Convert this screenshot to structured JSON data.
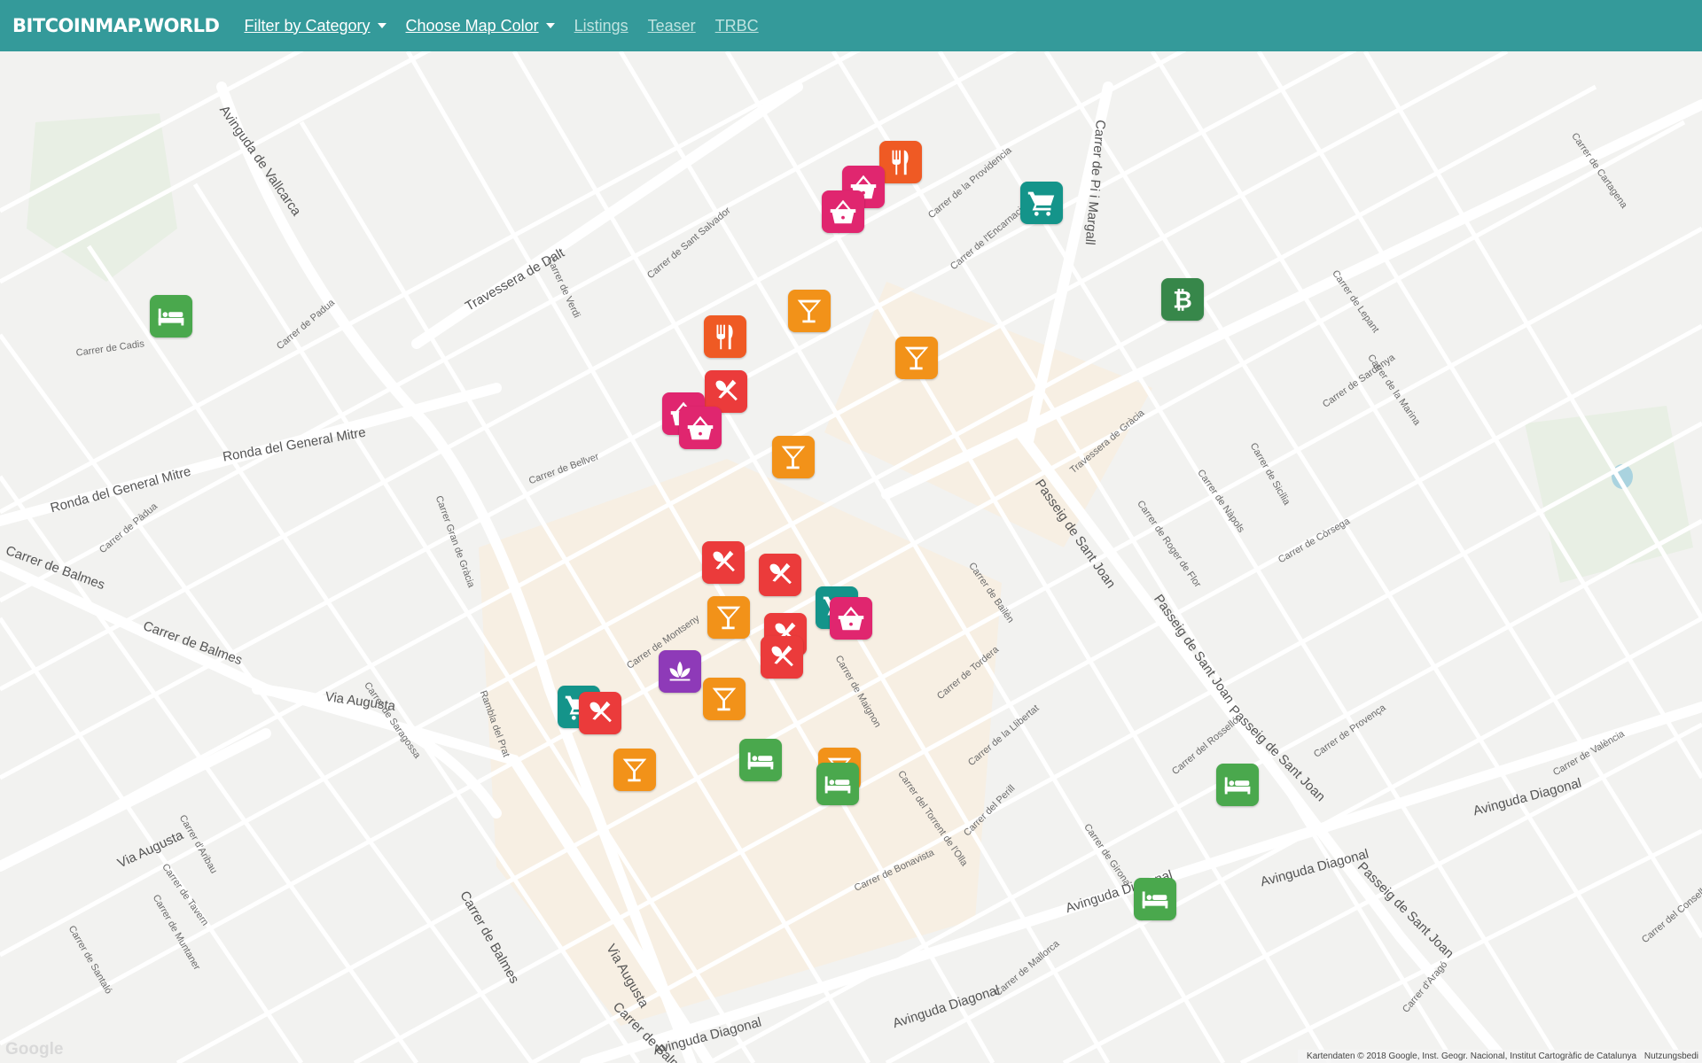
{
  "nav": {
    "brand": "BITCOINMAP.WORLD",
    "filter_label": "Filter by Category",
    "color_label": "Choose Map Color",
    "listings_label": "Listings",
    "teaser_label": "Teaser",
    "trbc_label": "TRBC"
  },
  "map": {
    "streets": [
      {
        "text": "Avinguda de Vallcarca",
        "big": true
      },
      {
        "text": "Travessera de Dalt",
        "big": true
      },
      {
        "text": "Ronda del General Mitre",
        "big": true
      },
      {
        "text": "Ronda del General Mitre",
        "big": true
      },
      {
        "text": "Carrer de Balmes",
        "big": true
      },
      {
        "text": "Carrer de Balmes",
        "big": true
      },
      {
        "text": "Via Augusta",
        "big": true
      },
      {
        "text": "Via Augusta",
        "big": true
      },
      {
        "text": "Via Augusta",
        "big": true
      },
      {
        "text": "Carrer de Balmes",
        "big": true
      },
      {
        "text": "Carrer de Balmes",
        "big": true
      },
      {
        "text": "Passeig de Sant Joan",
        "big": true
      },
      {
        "text": "Passeig de Sant Joan",
        "big": true
      },
      {
        "text": "Passeig de Sant Joan",
        "big": true
      },
      {
        "text": "Passeig de Sant Joan",
        "big": true
      },
      {
        "text": "Avinguda Diagonal",
        "big": true
      },
      {
        "text": "Avinguda Diagonal",
        "big": true
      },
      {
        "text": "Avinguda Diagonal",
        "big": true
      },
      {
        "text": "Avinguda Diagonal",
        "big": true
      },
      {
        "text": "Avinguda Diagonal",
        "big": true
      },
      {
        "text": "Carrer de Pi i Margall",
        "big": true
      },
      {
        "text": "Carrer de Cadis",
        "big": false
      },
      {
        "text": "Carrer de Padua",
        "big": false
      },
      {
        "text": "Carrer de Bellver",
        "big": false
      },
      {
        "text": "Carrer de Verdi",
        "big": false
      },
      {
        "text": "Carrer de Sant Salvador",
        "big": false
      },
      {
        "text": "Carrer de la Providencia",
        "big": false
      },
      {
        "text": "Carrer de l'Encarnació",
        "big": false
      },
      {
        "text": "Travessera de Gràcia",
        "big": false
      },
      {
        "text": "Carrer de Sardenya",
        "big": false
      },
      {
        "text": "Carrer de Sicília",
        "big": false
      },
      {
        "text": "Carrer de Nàpols",
        "big": false
      },
      {
        "text": "Carrer de Roger de Flor",
        "big": false
      },
      {
        "text": "Carrer de Còrsega",
        "big": false
      },
      {
        "text": "Carrer del Rosselló",
        "big": false
      },
      {
        "text": "Carrer de Provença",
        "big": false
      },
      {
        "text": "Carrer de València",
        "big": false
      },
      {
        "text": "Carrer de Girona",
        "big": false
      },
      {
        "text": "Carrer de Bailèn",
        "big": false
      },
      {
        "text": "Carrer de Tordera",
        "big": false
      },
      {
        "text": "Carrer de Montseny",
        "big": false
      },
      {
        "text": "Carrer de Saragossa",
        "big": false
      },
      {
        "text": "Rambla del Prat",
        "big": false
      },
      {
        "text": "Carrer de Santaló",
        "big": false
      },
      {
        "text": "Carrer de Muntaner",
        "big": false
      },
      {
        "text": "Carrer de Tavern",
        "big": false
      },
      {
        "text": "Carrer d'Aribau",
        "big": false
      },
      {
        "text": "Carrer de Lepant",
        "big": false
      },
      {
        "text": "Carrer de la Marina",
        "big": false
      },
      {
        "text": "Carrer de Cartagena",
        "big": false
      },
      {
        "text": "Carrer de Mallorca",
        "big": false
      },
      {
        "text": "Carrer del Consell de Cent",
        "big": false
      },
      {
        "text": "Carrer d'Aragó",
        "big": false
      },
      {
        "text": "Carrer de Pàdua",
        "big": false
      },
      {
        "text": "Carrer de Maignon",
        "big": false
      },
      {
        "text": "Carrer del Torrent de l'Olla",
        "big": false
      },
      {
        "text": "Carrer Gran de Gràcia",
        "big": false
      },
      {
        "text": "Carrer de Bonavista",
        "big": false
      },
      {
        "text": "Carrer del Perill",
        "big": false
      },
      {
        "text": "Carrer de la Llibertat",
        "big": false
      }
    ],
    "markers": [
      {
        "category": "restaurant",
        "color": "#ef5a24",
        "icon": "fork-knife-icon"
      },
      {
        "category": "shopping",
        "color": "#e0266f",
        "icon": "basket-icon"
      },
      {
        "category": "shopping",
        "color": "#e0266f",
        "icon": "basket-icon"
      },
      {
        "category": "grocery",
        "color": "#14948a",
        "icon": "cart-icon"
      },
      {
        "category": "bitcoin",
        "color": "#37874a",
        "icon": "bitcoin-icon"
      },
      {
        "category": "lodging",
        "color": "#4aa84d",
        "icon": "bed-icon"
      },
      {
        "category": "bar",
        "color": "#f29219",
        "icon": "cocktail-icon"
      },
      {
        "category": "restaurant",
        "color": "#ef5a24",
        "icon": "fork-knife-icon"
      },
      {
        "category": "bar",
        "color": "#f29219",
        "icon": "cocktail-icon"
      },
      {
        "category": "cafe",
        "color": "#eb3b3b",
        "icon": "spoon-knife-icon"
      },
      {
        "category": "shopping",
        "color": "#e0266f",
        "icon": "basket-icon"
      },
      {
        "category": "shopping",
        "color": "#e0266f",
        "icon": "basket-icon"
      },
      {
        "category": "bar",
        "color": "#f29219",
        "icon": "cocktail-icon"
      },
      {
        "category": "cafe",
        "color": "#eb3b3b",
        "icon": "spoon-knife-icon"
      },
      {
        "category": "cafe",
        "color": "#eb3b3b",
        "icon": "spoon-knife-icon"
      },
      {
        "category": "grocery",
        "color": "#14948a",
        "icon": "cart-icon"
      },
      {
        "category": "shopping",
        "color": "#e0266f",
        "icon": "basket-icon"
      },
      {
        "category": "bar",
        "color": "#f29219",
        "icon": "cocktail-icon"
      },
      {
        "category": "cafe",
        "color": "#eb3b3b",
        "icon": "spoon-knife-icon"
      },
      {
        "category": "cafe",
        "color": "#eb3b3b",
        "icon": "spoon-knife-icon"
      },
      {
        "category": "wellness",
        "color": "#8e3ab8",
        "icon": "lotus-icon"
      },
      {
        "category": "bar",
        "color": "#f29219",
        "icon": "cocktail-icon"
      },
      {
        "category": "grocery",
        "color": "#14948a",
        "icon": "cart-icon"
      },
      {
        "category": "cafe",
        "color": "#eb3b3b",
        "icon": "spoon-knife-icon"
      },
      {
        "category": "bar",
        "color": "#f29219",
        "icon": "cocktail-icon"
      },
      {
        "category": "lodging",
        "color": "#4aa84d",
        "icon": "bed-icon"
      },
      {
        "category": "bar",
        "color": "#f29219",
        "icon": "cocktail-icon"
      },
      {
        "category": "lodging",
        "color": "#4aa84d",
        "icon": "bed-icon"
      },
      {
        "category": "lodging",
        "color": "#4aa84d",
        "icon": "bed-icon"
      },
      {
        "category": "lodging",
        "color": "#4aa84d",
        "icon": "bed-icon"
      }
    ],
    "google_logo": "Google",
    "attribution": "Kartendaten © 2018 Google, Inst. Geogr. Nacional, Institut Cartogràfic de Catalunya",
    "terms": "Nutzungsbedi"
  }
}
